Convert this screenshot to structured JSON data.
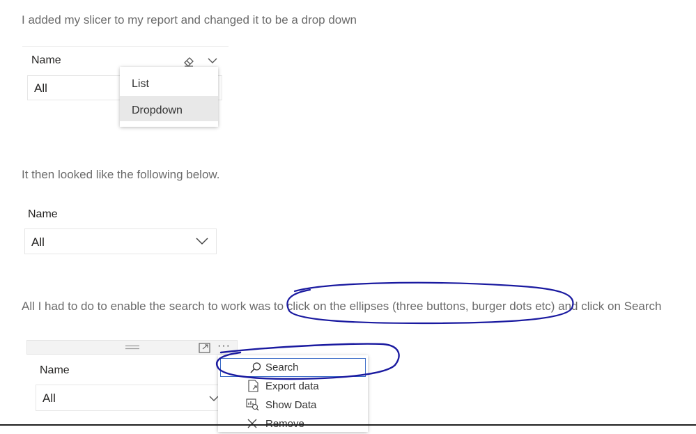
{
  "paragraphs": {
    "p1": "I added my slicer to my report and changed it to be a drop down",
    "p2": "It then looked like the following below.",
    "p3": "All I had to do to enable the search to work was to click on the ellipses (three buttons, burger dots etc) and click on Search"
  },
  "slicer1": {
    "title": "Name",
    "value": "All",
    "menu": {
      "items": [
        "List",
        "Dropdown"
      ],
      "selected": "Dropdown"
    }
  },
  "slicer2": {
    "title": "Name",
    "value": "All"
  },
  "slicer3": {
    "title": "Name",
    "value": "All",
    "more_glyph": "···",
    "menu": {
      "items": [
        "Search",
        "Export data",
        "Show Data",
        "Remove"
      ],
      "highlighted": "Search"
    }
  },
  "annotations": {
    "ink_color": "#1a1aa0"
  }
}
